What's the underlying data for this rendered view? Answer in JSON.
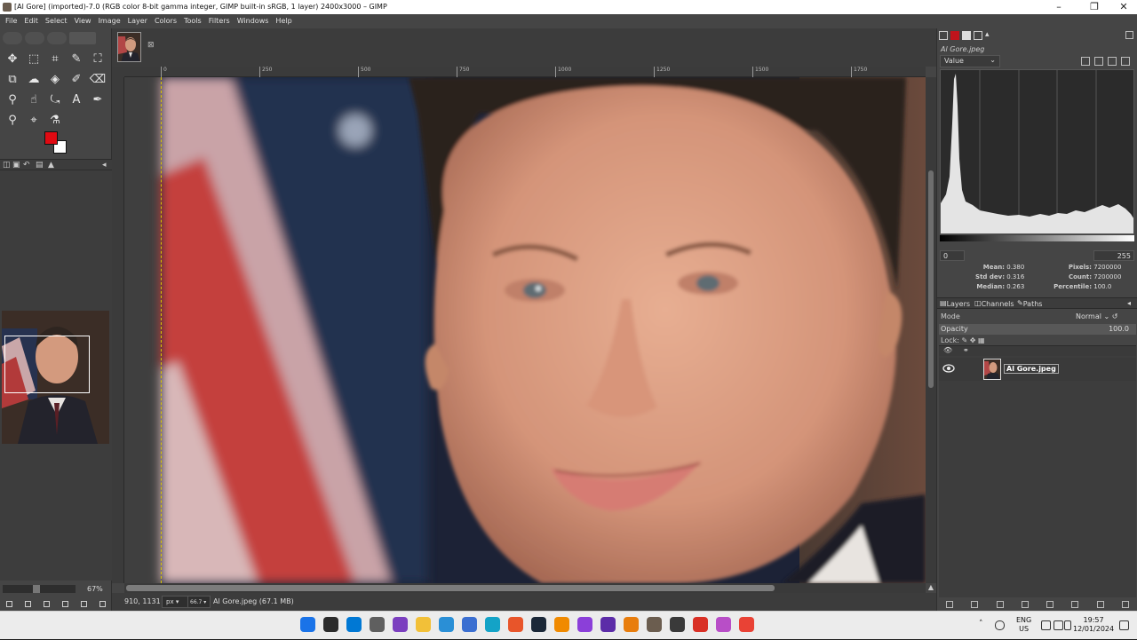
{
  "window": {
    "title": "[Al Gore] (imported)-7.0 (RGB color 8-bit gamma integer, GIMP built-in sRGB, 1 layer) 2400x3000 – GIMP",
    "minimize_glyph": "–",
    "maximize_glyph": "❐",
    "close_glyph": "✕"
  },
  "menubar": {
    "items": [
      "File",
      "Edit",
      "Select",
      "View",
      "Image",
      "Layer",
      "Colors",
      "Tools",
      "Filters",
      "Windows",
      "Help"
    ]
  },
  "toolbox": {
    "tools": [
      {
        "name": "move-tool-icon",
        "glyph": "✥"
      },
      {
        "name": "rect-select-tool-icon",
        "glyph": "⬚"
      },
      {
        "name": "crop-tool-icon",
        "glyph": "⌗"
      },
      {
        "name": "fuzzy-select-tool-icon",
        "glyph": "✎"
      },
      {
        "name": "crop-frame-tool-icon",
        "glyph": "⛶"
      },
      {
        "name": "unified-transform-tool-icon",
        "glyph": "⧉"
      },
      {
        "name": "warp-tool-icon",
        "glyph": "☁"
      },
      {
        "name": "bucket-fill-tool-icon",
        "glyph": "◈"
      },
      {
        "name": "paintbrush-tool-icon",
        "glyph": "✐"
      },
      {
        "name": "eraser-tool-icon",
        "glyph": "⌫"
      },
      {
        "name": "clone-tool-icon",
        "glyph": "⚲"
      },
      {
        "name": "smudge-tool-icon",
        "glyph": "☝"
      },
      {
        "name": "paths-tool-icon",
        "glyph": "⤿"
      },
      {
        "name": "text-tool-icon",
        "glyph": "A"
      },
      {
        "name": "color-picker-tool-icon",
        "glyph": "✒"
      },
      {
        "name": "zoom-tool-icon",
        "glyph": "⚲"
      },
      {
        "name": "measure-tool-icon",
        "glyph": "⌖"
      },
      {
        "name": "gegl-tool-icon",
        "glyph": "⚗"
      }
    ],
    "foreground_color": "#e00a12",
    "background_color": "#ffffff",
    "zoom_label": "67%"
  },
  "canvas": {
    "ruler_ticks": [
      "0",
      "250",
      "500",
      "750",
      "1000",
      "1250",
      "1500",
      "1750"
    ],
    "pointer_coords": "910, 1131",
    "unit": "px",
    "zoom_value": "66.7",
    "image_info": "Al Gore.jpeg (67.1 MB)",
    "close_glyph": "⊠"
  },
  "histogram": {
    "title": "Al Gore.jpeg",
    "channel": "Value",
    "range_min": "0",
    "range_max": "255",
    "stats_left": [
      {
        "label": "Mean:",
        "value": "0.380"
      },
      {
        "label": "Std dev:",
        "value": "0.316"
      },
      {
        "label": "Median:",
        "value": "0.263"
      }
    ],
    "stats_right": [
      {
        "label": "Pixels:",
        "value": "7200000"
      },
      {
        "label": "Count:",
        "value": "7200000"
      },
      {
        "label": "Percentile:",
        "value": "100.0"
      }
    ]
  },
  "layers": {
    "tabs": [
      "Layers",
      "Channels",
      "Paths"
    ],
    "mode_label": "Mode",
    "mode_value": "Normal",
    "opacity_label": "Opacity",
    "opacity_value": "100.0",
    "lock_label": "Lock:",
    "layer_name": "Al Gore.jpeg"
  },
  "taskbar": {
    "apps": [
      {
        "name": "windows-start-icon",
        "color": "#1a73e8"
      },
      {
        "name": "terminal-icon",
        "color": "#2b2b2b"
      },
      {
        "name": "store-icon",
        "color": "#0078d4"
      },
      {
        "name": "clock-app-icon",
        "color": "#5f5f5f"
      },
      {
        "name": "visual-studio-icon",
        "color": "#7b3fbf"
      },
      {
        "name": "file-explorer-icon",
        "color": "#f2c038"
      },
      {
        "name": "notepad-icon",
        "color": "#2a8fd6"
      },
      {
        "name": "whiteboard-icon",
        "color": "#3b6fd1"
      },
      {
        "name": "edge-icon",
        "color": "#14a3c7"
      },
      {
        "name": "brave-icon",
        "color": "#e8552a"
      },
      {
        "name": "steam-icon",
        "color": "#1b2838"
      },
      {
        "name": "vlc-icon",
        "color": "#f08a00"
      },
      {
        "name": "app-purple-icon",
        "color": "#8b3fd9"
      },
      {
        "name": "app-violet-icon",
        "color": "#5c2ca8"
      },
      {
        "name": "blender-icon",
        "color": "#e87d0d"
      },
      {
        "name": "gimp-icon",
        "color": "#6b5d4f"
      },
      {
        "name": "app-dark-icon",
        "color": "#3a3a3a"
      },
      {
        "name": "chrome-dev-icon",
        "color": "#d93025"
      },
      {
        "name": "color-app-icon",
        "color": "#b84ec7"
      },
      {
        "name": "chrome-icon",
        "color": "#e94235"
      }
    ],
    "lang_line1": "ENG",
    "lang_line2": "US",
    "time": "19:57",
    "date": "12/01/2024"
  }
}
